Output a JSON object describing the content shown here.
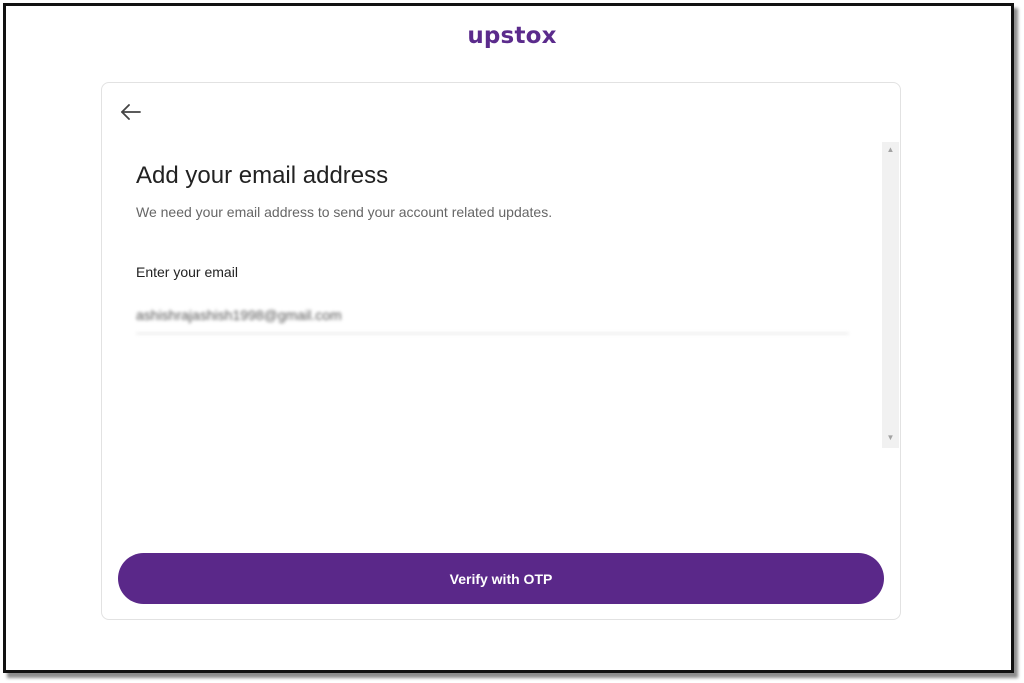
{
  "brand": {
    "logo_text": "upstox",
    "color": "#5b2b8c"
  },
  "header": {
    "back_icon": "arrow-left-icon"
  },
  "form": {
    "title": "Add your email address",
    "subtitle": "We need your email address to send your account related updates.",
    "email_label": "Enter your email",
    "email_value": "ashishrajashish1998@gmail.com"
  },
  "actions": {
    "verify_label": "Verify with OTP",
    "accent_color": "#5a2889"
  },
  "scrollbar": {
    "up_icon": "scroll-up-arrow-icon",
    "down_icon": "scroll-down-arrow-icon"
  }
}
